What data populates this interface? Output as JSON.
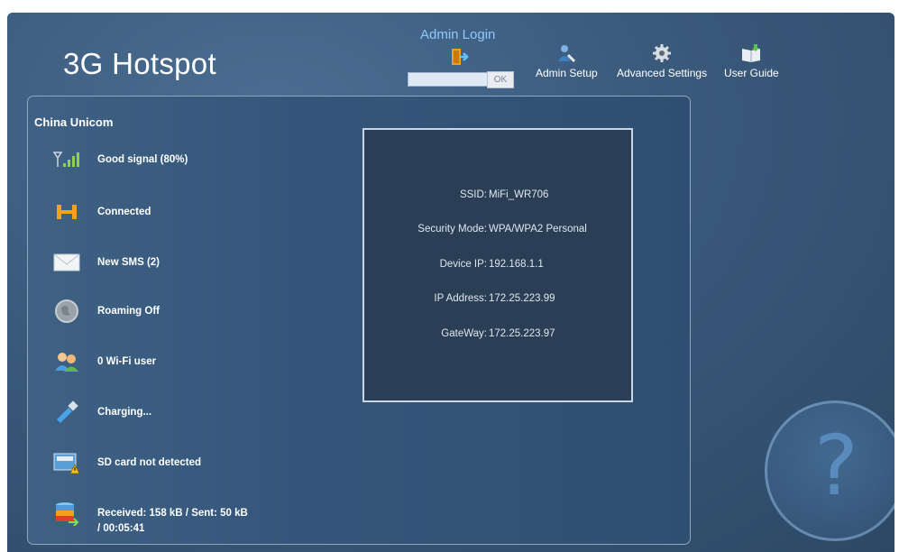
{
  "header": {
    "app_title": "3G Hotspot",
    "admin_login_label": "Admin Login",
    "password_value": "",
    "ok_label": "OK",
    "links": [
      {
        "label": "Admin Setup",
        "icon": "admin-user-icon"
      },
      {
        "label": "Advanced Settings",
        "icon": "gear-icon"
      },
      {
        "label": "User Guide",
        "icon": "book-icon"
      }
    ]
  },
  "status": {
    "carrier": "China Unicom",
    "signal": "Good signal (80%)",
    "connection": "Connected",
    "sms": "New SMS  (2)",
    "roaming": "Roaming Off",
    "wifi_users": "0 Wi-Fi user",
    "battery": "Charging...",
    "sd_card": "SD card not detected",
    "traffic_line1": "Received: 158 kB / Sent: 50 kB",
    "traffic_line2": "/ 00:05:41"
  },
  "info": {
    "ssid_label": "SSID:",
    "ssid_value": "MiFi_WR706",
    "security_label": "Security Mode:",
    "security_value": "WPA/WPA2 Personal",
    "device_ip_label": "Device IP:",
    "device_ip_value": "192.168.1.1",
    "ip_label": "IP Address:",
    "ip_value": "172.25.223.99",
    "gateway_label": "GateWay:",
    "gateway_value": "172.25.223.97"
  },
  "colors": {
    "background": "#3a5a7c",
    "accent_link": "#8ec8ff",
    "info_box": "#2a3f55"
  }
}
